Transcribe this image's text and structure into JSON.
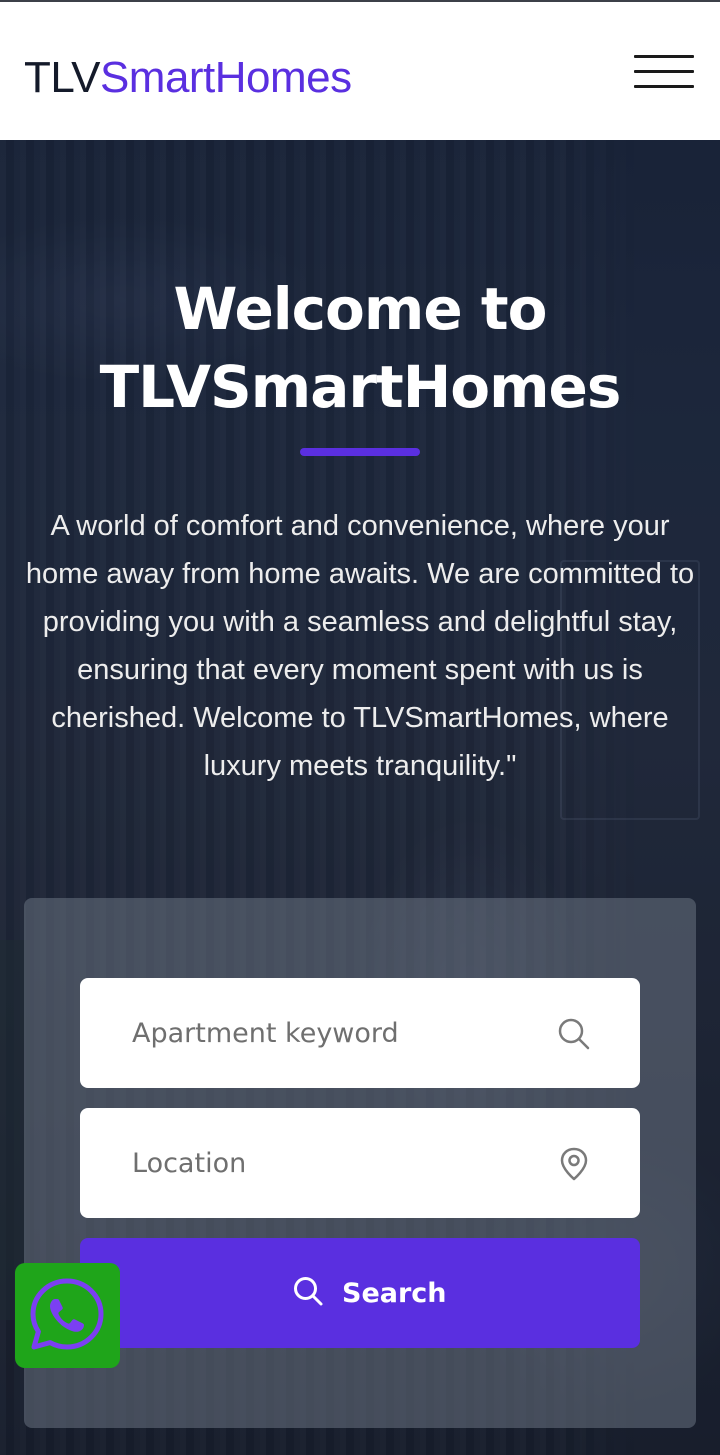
{
  "header": {
    "logo_part1": "TLV",
    "logo_part2": "SmartHomes",
    "menu_icon": "hamburger-menu-icon"
  },
  "hero": {
    "title_line1": "Welcome to",
    "title_line2": "TLVSmartHomes",
    "description": "A world of comfort and convenience, where your home away from home awaits. We are committed to providing you with a seamless and delightful stay, ensuring that every moment spent with us is cherished. Welcome to TLVSmartHomes, where luxury meets tranquility.\""
  },
  "search": {
    "keyword_placeholder": "Apartment keyword",
    "keyword_icon": "search-icon",
    "location_placeholder": "Location",
    "location_icon": "map-pin-icon",
    "button_label": "Search",
    "button_icon": "search-icon"
  },
  "floating": {
    "whatsapp_icon": "whatsapp-icon"
  },
  "colors": {
    "brand_purple": "#5a2fe0",
    "logo_dark": "#141a2a",
    "whatsapp_green": "#1fa51a"
  }
}
